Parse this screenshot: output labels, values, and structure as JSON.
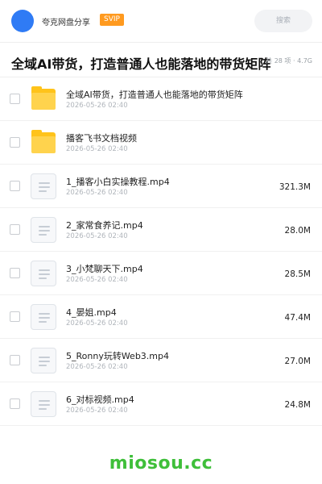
{
  "header": {
    "share_title": "夸克网盘分享",
    "badge": "SVIP",
    "search_placeholder": "搜索"
  },
  "folder": {
    "title": "全域AI带货，打造普通人也能落地的带货矩阵",
    "meta": "共 28 项 · 4.7G"
  },
  "files": [
    {
      "name": "全域AI带货，打造普通人也能落地的带货矩阵",
      "date": "2026-05-26 02:40",
      "size": "",
      "type": "folder"
    },
    {
      "name": "播客飞书文档视频",
      "date": "2026-05-26 02:40",
      "size": "",
      "type": "folder"
    },
    {
      "name": "1_播客小白实操教程.mp4",
      "date": "2026-05-26 02:40",
      "size": "321.3M",
      "type": "video"
    },
    {
      "name": "2_家常食养记.mp4",
      "date": "2026-05-26 02:40",
      "size": "28.0M",
      "type": "video"
    },
    {
      "name": "3_小梵聊天下.mp4",
      "date": "2026-05-26 02:40",
      "size": "28.5M",
      "type": "video"
    },
    {
      "name": "4_晏姐.mp4",
      "date": "2026-05-26 02:40",
      "size": "47.4M",
      "type": "video"
    },
    {
      "name": "5_Ronny玩转Web3.mp4",
      "date": "2026-05-26 02:40",
      "size": "27.0M",
      "type": "video"
    },
    {
      "name": "6_对标视频.mp4",
      "date": "2026-05-26 02:40",
      "size": "24.8M",
      "type": "video"
    }
  ],
  "footer": {
    "brand": "miosou.cc"
  },
  "colors": {
    "accent": "#2f7bf5",
    "badge": "#ff9a1f",
    "folder": "#ffc31a",
    "brand": "#3fbf3a"
  }
}
